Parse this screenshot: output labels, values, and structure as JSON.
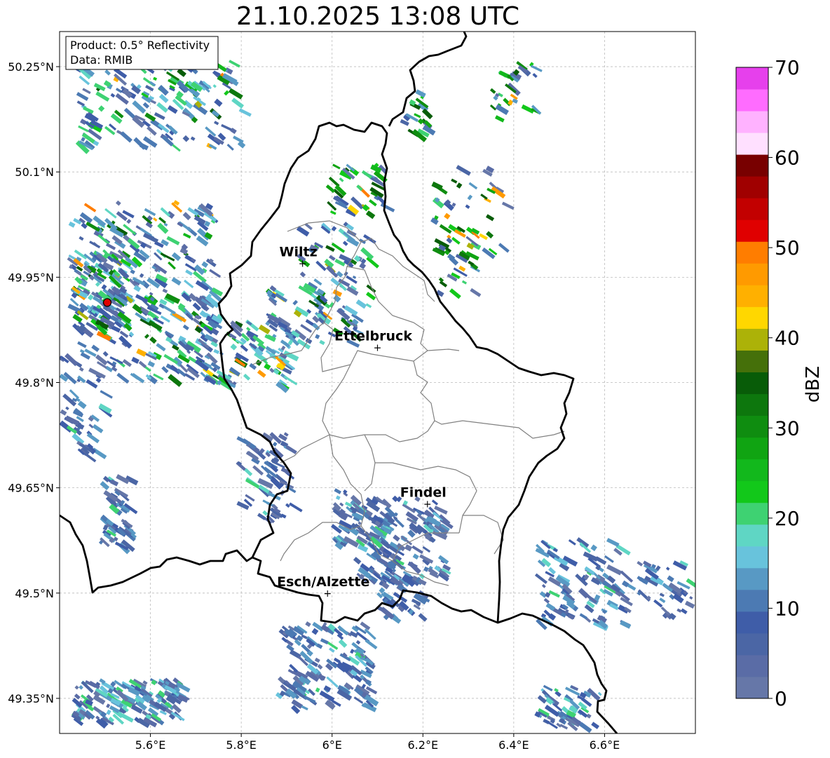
{
  "title": "21.10.2025 13:08 UTC",
  "info_box": {
    "product": "Product: 0.5° Reflectivity",
    "data": "Data: RMIB"
  },
  "axes": {
    "lon_ticks": [
      "5.6°E",
      "5.8°E",
      "6°E",
      "6.2°E",
      "6.4°E",
      "6.6°E"
    ],
    "lat_ticks": [
      "50.25°N",
      "50.1°N",
      "49.95°N",
      "49.8°N",
      "49.65°N",
      "49.5°N",
      "49.35°N"
    ]
  },
  "cities": [
    {
      "name": "Wiltz",
      "lon": 5.935,
      "lat": 49.97
    },
    {
      "name": "Ettelbruck",
      "lon": 6.1,
      "lat": 49.85
    },
    {
      "name": "Findel",
      "lon": 6.21,
      "lat": 49.627
    },
    {
      "name": "Esch/Alzette",
      "lon": 5.99,
      "lat": 49.5
    }
  ],
  "radar_site": {
    "lon": 5.505,
    "lat": 49.914
  },
  "colorbar": {
    "label": "dBZ",
    "min": 0,
    "max": 70,
    "step": 2.5,
    "tick_labels": [
      "0",
      "10",
      "20",
      "30",
      "40",
      "50",
      "60",
      "70"
    ],
    "colors": [
      "#6677a8",
      "#5a6ca6",
      "#4b66a5",
      "#3f5da8",
      "#4c7ab3",
      "#5899c4",
      "#68c3dc",
      "#5fd6c4",
      "#3ed272",
      "#12c81a",
      "#12b81c",
      "#10a412",
      "#0f8d10",
      "#0d770d",
      "#085c08",
      "#45700a",
      "#acb208",
      "#ffd700",
      "#ffb000",
      "#ff9a00",
      "#ff7d00",
      "#e00000",
      "#c20000",
      "#a00000",
      "#780000",
      "#ffe0ff",
      "#ffb2ff",
      "#ff6cff",
      "#e640ec"
    ]
  },
  "palette": {
    "border": "#000000",
    "district": "#808080",
    "grid": "#bbbbbb"
  }
}
